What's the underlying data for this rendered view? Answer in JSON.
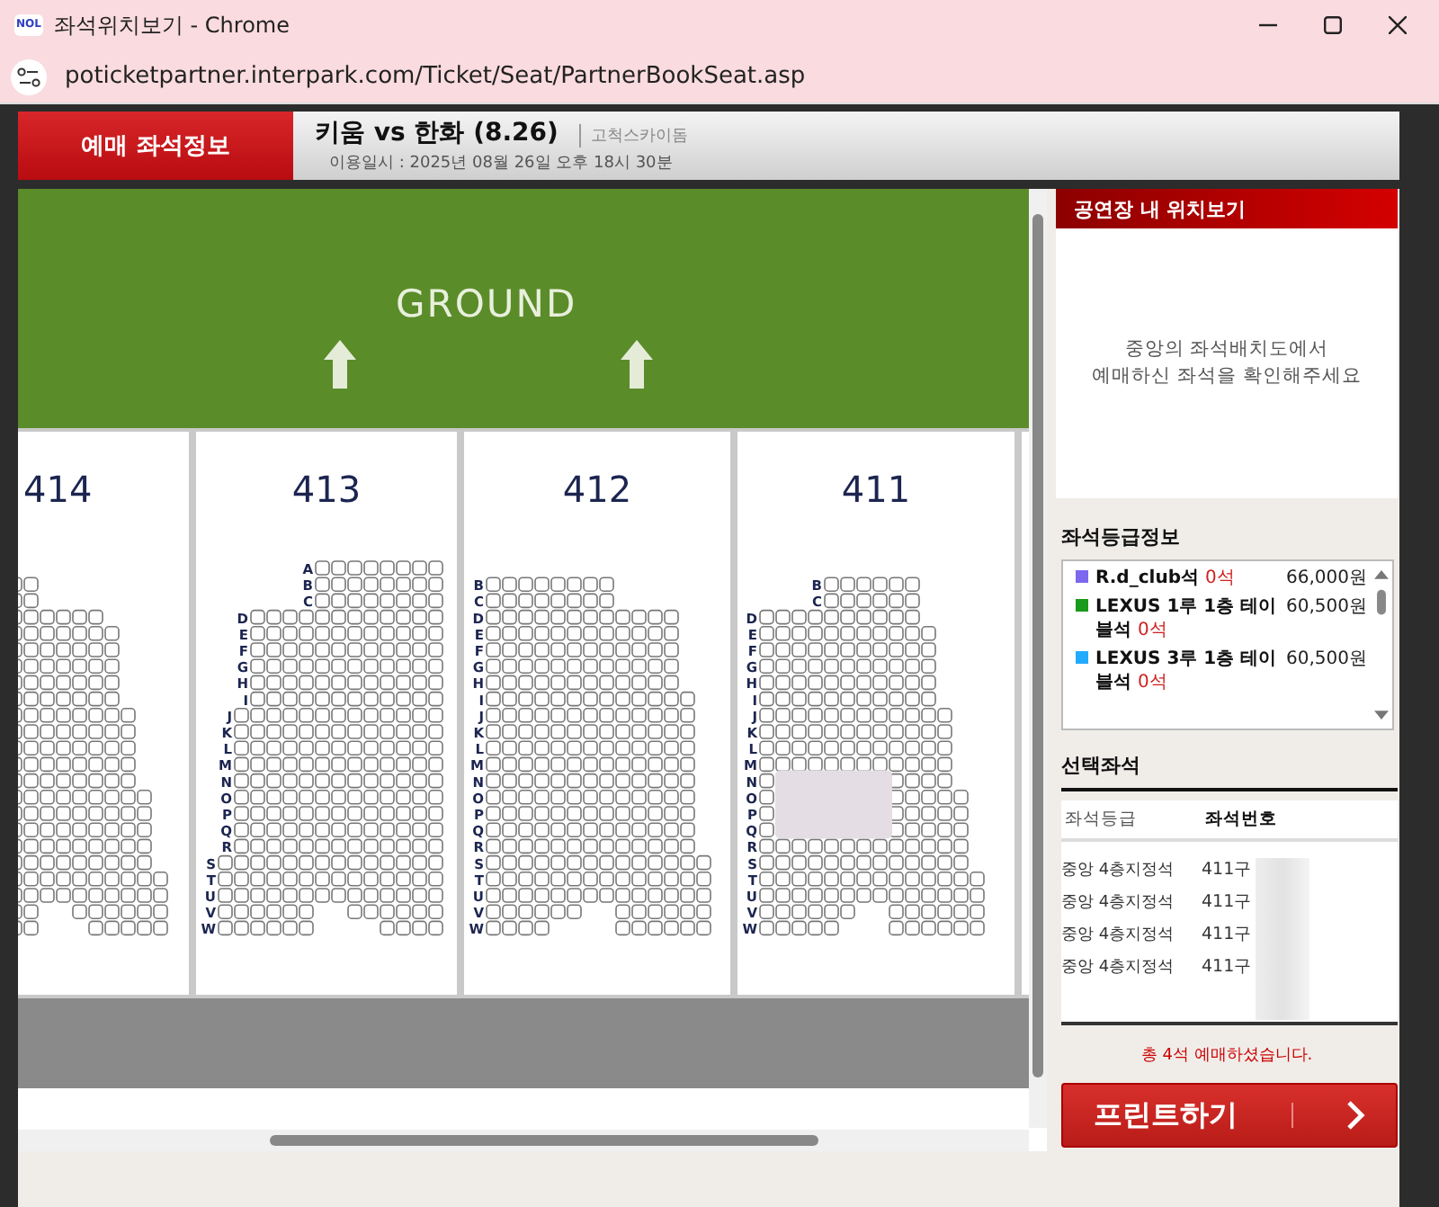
{
  "window": {
    "app_icon": "NOL",
    "title": "좌석위치보기 - Chrome",
    "url": "poticketpartner.interpark.com/Ticket/Seat/PartnerBookSeat.asp"
  },
  "header": {
    "tab": "예매 좌석정보",
    "event_title": "키움 vs 한화 (8.26)",
    "venue": "고척스카이돔",
    "date": "이용일시 : 2025년 08월 26일 오후 18시 30분"
  },
  "seat_map": {
    "ground_label": "GROUND",
    "sections": [
      {
        "number": "414"
      },
      {
        "number": "413",
        "rows": [
          "A",
          "B",
          "C",
          "D",
          "E",
          "F",
          "G",
          "H",
          "I",
          "J",
          "K",
          "L",
          "M",
          "N",
          "O",
          "P",
          "Q",
          "R",
          "S",
          "T",
          "U",
          "V",
          "W"
        ]
      },
      {
        "number": "412",
        "rows": [
          "B",
          "C",
          "D",
          "E",
          "F",
          "G",
          "H",
          "I",
          "J",
          "K",
          "L",
          "M",
          "N",
          "O",
          "P",
          "Q",
          "R",
          "S",
          "T",
          "U",
          "V",
          "W"
        ]
      },
      {
        "number": "411",
        "rows": [
          "B",
          "C",
          "D",
          "E",
          "F",
          "G",
          "H",
          "I",
          "J",
          "K",
          "L",
          "M",
          "N",
          "O",
          "P",
          "Q",
          "R",
          "S",
          "T",
          "U",
          "V",
          "W"
        ]
      }
    ]
  },
  "side": {
    "location_title": "공연장 내 위치보기",
    "location_message": [
      "중앙의 좌석배치도에서",
      "예매하신 좌석을 확인해주세요"
    ],
    "grades_title": "좌석등급정보",
    "grades": [
      {
        "name": "R.d_club석",
        "count": "0석",
        "price": "66,000원",
        "color": "#7b68ee"
      },
      {
        "name": "LEXUS 1루 1층 테이블석",
        "count": "0석",
        "price": "60,500원",
        "color": "#1a9a1a"
      },
      {
        "name": "LEXUS 3루 1층 테이블석",
        "count": "0석",
        "price": "60,500원",
        "color": "#22aaff"
      }
    ],
    "selected_title": "선택좌석",
    "columns": [
      "좌석등급",
      "좌석번호"
    ],
    "selected_seats": [
      {
        "grade": "중앙 4층지정석",
        "seat": "411구"
      },
      {
        "grade": "중앙 4층지정석",
        "seat": "411구"
      },
      {
        "grade": "중앙 4층지정석",
        "seat": "411구"
      },
      {
        "grade": "중앙 4층지정석",
        "seat": "411구"
      }
    ],
    "total": "총 4석 예매하셨습니다.",
    "print_button": "프린트하기"
  }
}
